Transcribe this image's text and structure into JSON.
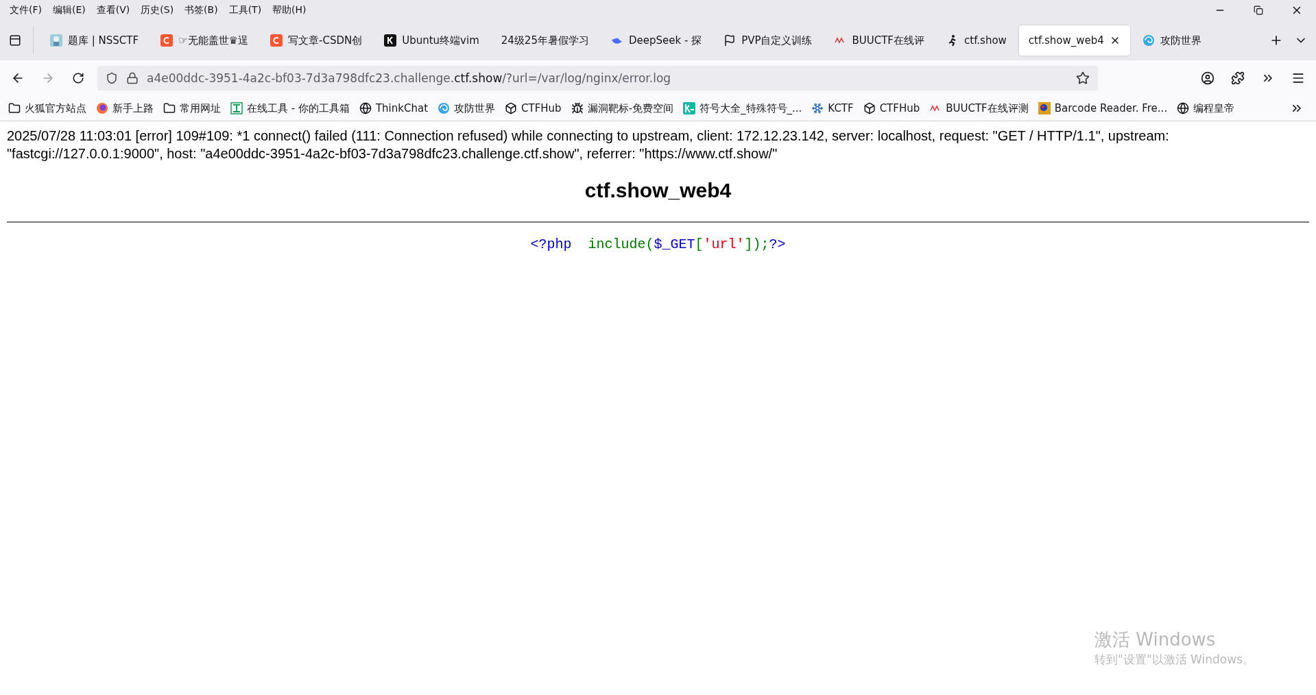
{
  "menu_bar": [
    "文件(F)",
    "编辑(E)",
    "查看(V)",
    "历史(S)",
    "书签(B)",
    "工具(T)",
    "帮助(H)"
  ],
  "tabs": [
    {
      "label": "题库 | NSSCTF",
      "kind": "nss",
      "selected": false
    },
    {
      "label": "☞无能盖世♛逞",
      "kind": "csdn",
      "selected": false
    },
    {
      "label": "写文章-CSDN创",
      "kind": "csdn",
      "selected": false
    },
    {
      "label": "Ubuntu终端vim",
      "kind": "k",
      "selected": false
    },
    {
      "label": "24级25年暑假学习",
      "selected": false
    },
    {
      "label": "DeepSeek - 探",
      "kind": "whale",
      "selected": false
    },
    {
      "label": "PVP自定义训练",
      "kind": "flag",
      "selected": false
    },
    {
      "label": "BUUCTF在线评",
      "kind": "buu",
      "selected": false
    },
    {
      "label": "ctf.show",
      "kind": "runner",
      "selected": false
    },
    {
      "label": "ctf.show_web4",
      "selected": true
    },
    {
      "label": "攻防世界",
      "kind": "swirl",
      "selected": false
    }
  ],
  "address_bar": {
    "prefix": "a4e00ddc-3951-4a2c-bf03-7d3a798dfc23.challenge.",
    "domain": "ctf.show",
    "suffix": "/?url=/var/log/nginx/error.log"
  },
  "bookmarks": [
    {
      "label": "火狐官方站点",
      "kind": "folder"
    },
    {
      "label": "新手上路",
      "kind": "firefox"
    },
    {
      "label": "常用网址",
      "kind": "folder"
    },
    {
      "label": "在线工具 - 你的工具箱",
      "kind": "tool"
    },
    {
      "label": "ThinkChat",
      "kind": "globe"
    },
    {
      "label": "攻防世界",
      "kind": "swirl"
    },
    {
      "label": "CTFHub",
      "kind": "hub"
    },
    {
      "label": "漏洞靶标-免费空间",
      "kind": "bug"
    },
    {
      "label": "符号大全_特殊符号_...",
      "kind": "ke"
    },
    {
      "label": "KCTF",
      "kind": "snowflake"
    },
    {
      "label": "CTFHub",
      "kind": "hub"
    },
    {
      "label": "BUUCTF在线评测",
      "kind": "buu"
    },
    {
      "label": "Barcode Reader. Fre...",
      "kind": "barcode"
    },
    {
      "label": "编程皇帝",
      "kind": "globe"
    }
  ],
  "page": {
    "error_log": "2025/07/28 11:03:01 [error] 109#109: *1 connect() failed (111: Connection refused) while connecting to upstream, client: 172.12.23.142, server: localhost, request: \"GET / HTTP/1.1\", upstream: \"fastcgi://127.0.0.1:9000\", host: \"a4e00ddc-3951-4a2c-bf03-7d3a798dfc23.challenge.ctf.show\", referrer: \"https://www.ctf.show/\"",
    "title": "ctf.show_web4",
    "code": [
      {
        "text": "<?php",
        "kind": "tag"
      },
      {
        "text": "  include",
        "kind": "keyword"
      },
      {
        "text": "(",
        "kind": "keyword"
      },
      {
        "text": "$_GET",
        "kind": "tag"
      },
      {
        "text": "[",
        "kind": "keyword"
      },
      {
        "text": "'url'",
        "kind": "string"
      },
      {
        "text": "]);",
        "kind": "keyword"
      },
      {
        "text": "?>",
        "kind": "tag"
      }
    ]
  },
  "activation_notice": {
    "title": "激活 Windows",
    "subtitle": "转到\"设置\"以激活 Windows。"
  }
}
